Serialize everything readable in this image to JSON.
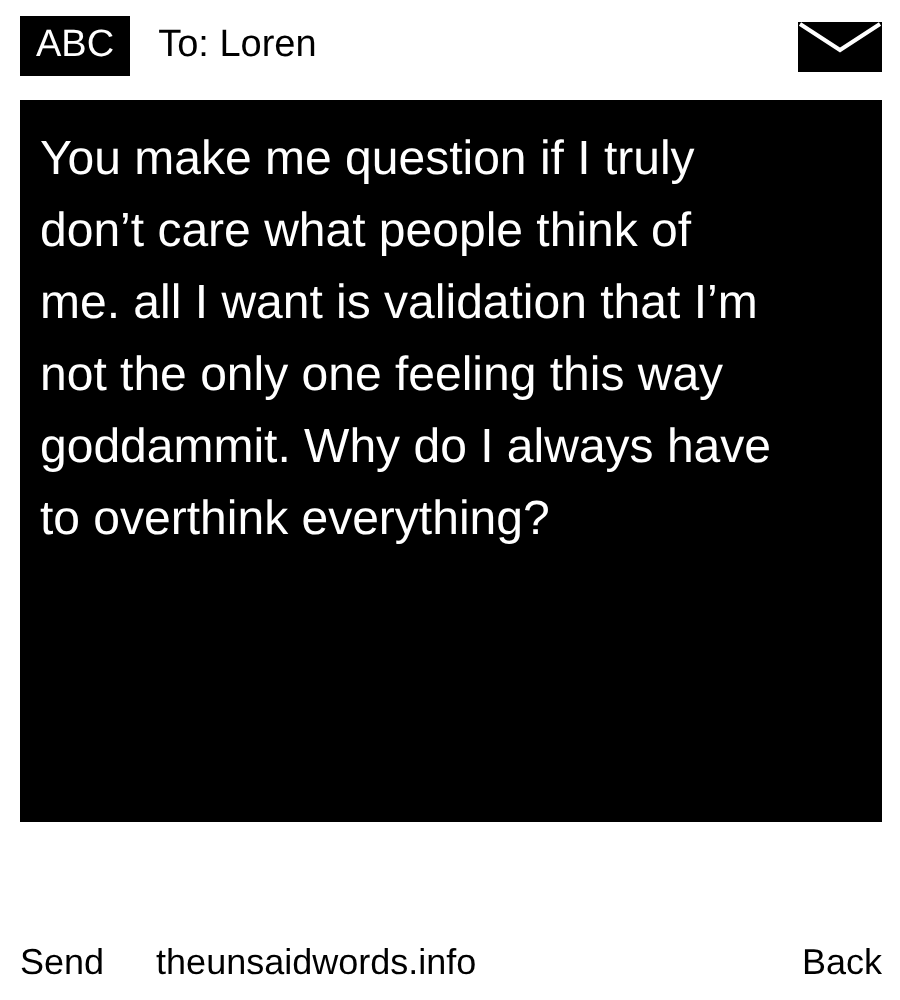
{
  "header": {
    "input_mode": "ABC",
    "recipient": "To: Loren"
  },
  "message": {
    "text": "You make me question if I truly don’t care what people think of me. all I want is validation that I’m not the only one feeling this way goddammit. Why do I always have to overthink everything?"
  },
  "softkeys": {
    "left": "Send",
    "center": "theunsaidwords.info",
    "right": "Back"
  }
}
